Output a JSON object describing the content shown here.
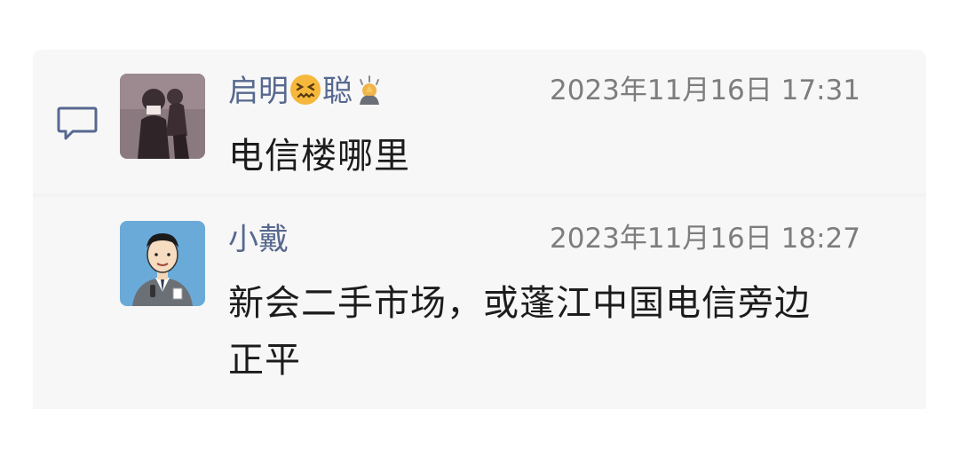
{
  "comments": [
    {
      "author": "启明",
      "author_suffix": "聪",
      "author_emojis": [
        "confounded-face-emoji",
        "pray-emoji"
      ],
      "timestamp": "2023年11月16日 17:31",
      "text": "电信楼哪里",
      "avatar": "dark-photo-avatar"
    },
    {
      "author": "小戴",
      "timestamp": "2023年11月16日 18:27",
      "text_line1": "新会二手市场，或蓬江中国电信旁边",
      "text_line2": "正平",
      "avatar": "cartoon-man-avatar"
    }
  ],
  "colors": {
    "name": "#57688f",
    "timestamp": "#7d7d7d",
    "text": "#1c1c1c",
    "panel": "#f7f7f7",
    "icon": "#57688f"
  }
}
